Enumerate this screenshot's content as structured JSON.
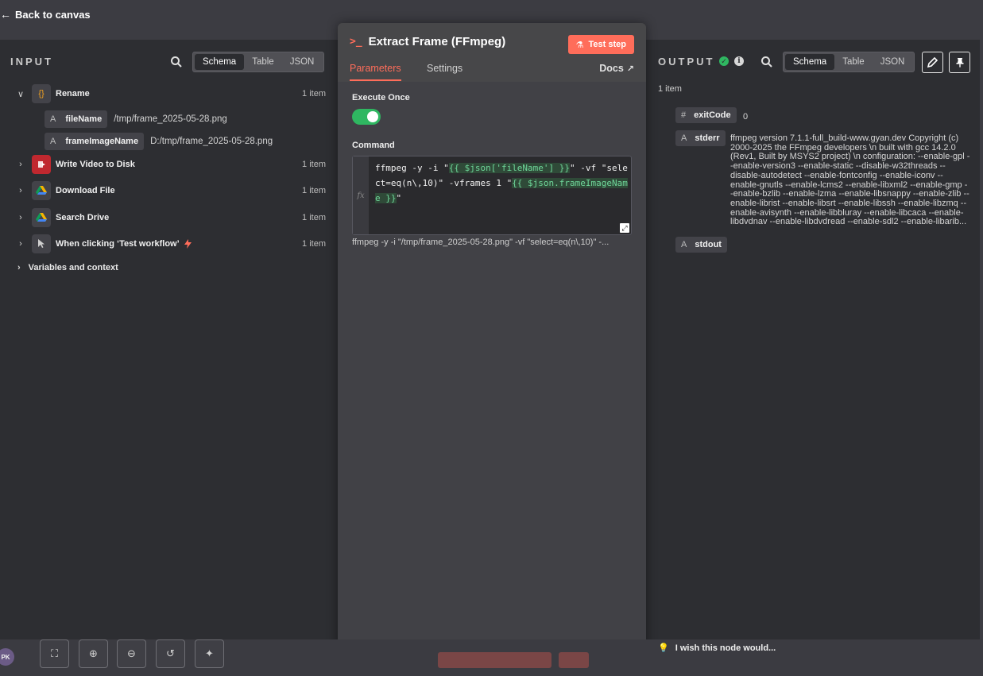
{
  "back_label": "Back to canvas",
  "input": {
    "title": "INPUT",
    "view_tabs": [
      "Schema",
      "Table",
      "JSON"
    ],
    "active_tab": "Schema",
    "nodes": [
      {
        "name": "Rename",
        "count": "1 item",
        "icon": "braces-icon",
        "expanded": true,
        "fields": [
          {
            "type": "A",
            "name": "fileName",
            "value": "/tmp/frame_2025-05-28.png"
          },
          {
            "type": "A",
            "name": "frameImageName",
            "value": "D:/tmp/frame_2025-05-28.png"
          }
        ]
      },
      {
        "name": "Write Video to Disk",
        "count": "1 item",
        "icon": "file-write-icon"
      },
      {
        "name": "Download File",
        "count": "1 item",
        "icon": "google-drive-icon"
      },
      {
        "name": "Search Drive",
        "count": "1 item",
        "icon": "google-drive-icon"
      },
      {
        "name": "When clicking ‘Test workflow’",
        "count": "1 item",
        "icon": "cursor-icon"
      }
    ],
    "variables_label": "Variables and context"
  },
  "node": {
    "title": "Extract Frame (FFmpeg)",
    "test_step_label": "Test step",
    "tabs": [
      "Parameters",
      "Settings"
    ],
    "active_tab": "Parameters",
    "docs_label": "Docs",
    "execute_once_label": "Execute Once",
    "execute_once_value": true,
    "command_label": "Command",
    "command_parts": {
      "p1": "ffmpeg -y -i \"",
      "expr1": "{{ $json['fileName'] }}",
      "p2": "\" -vf \"select=eq(n\\,10)\" -vframes 1 \"",
      "expr2": "{{ $json.frameImageName }}",
      "p3": "\""
    },
    "fx_label": "fx",
    "command_preview": "ffmpeg -y -i \"/tmp/frame_2025-05-28.png\" -vf \"select=eq(n\\,10)\" -..."
  },
  "output": {
    "title": "OUTPUT",
    "view_tabs": [
      "Schema",
      "Table",
      "JSON"
    ],
    "active_tab": "Schema",
    "item_count": "1 item",
    "status_color": "#2fb761",
    "fields": [
      {
        "type": "#",
        "name": "exitCode",
        "value": "0"
      },
      {
        "type": "A",
        "name": "stderr",
        "value": "ffmpeg version 7.1.1-full_build-www.gyan.dev Copyright (c) 2000-2025 the FFmpeg developers \\n  built with gcc 14.2.0 (Rev1, Built by MSYS2 project) \\n  configuration: --enable-gpl --enable-version3 --enable-static --disable-w32threads --disable-autodetect --enable-fontconfig --enable-iconv --enable-gnutls --enable-lcms2 --enable-libxml2 --enable-gmp --enable-bzlib --enable-lzma --enable-libsnappy --enable-zlib --enable-librist --enable-libsrt --enable-libssh --enable-libzmq --enable-avisynth --enable-libbluray --enable-libcaca --enable-libdvdnav --enable-libdvdread --enable-sdl2 --enable-libarib..."
      },
      {
        "type": "A",
        "name": "stdout",
        "value": ""
      }
    ]
  },
  "footer": {
    "avatar_initials": "PK",
    "wish_label": "I wish this node would..."
  },
  "colors": {
    "accent": "#ff6d5a",
    "success": "#2fb761",
    "panel_bg": "#2d2e32"
  }
}
